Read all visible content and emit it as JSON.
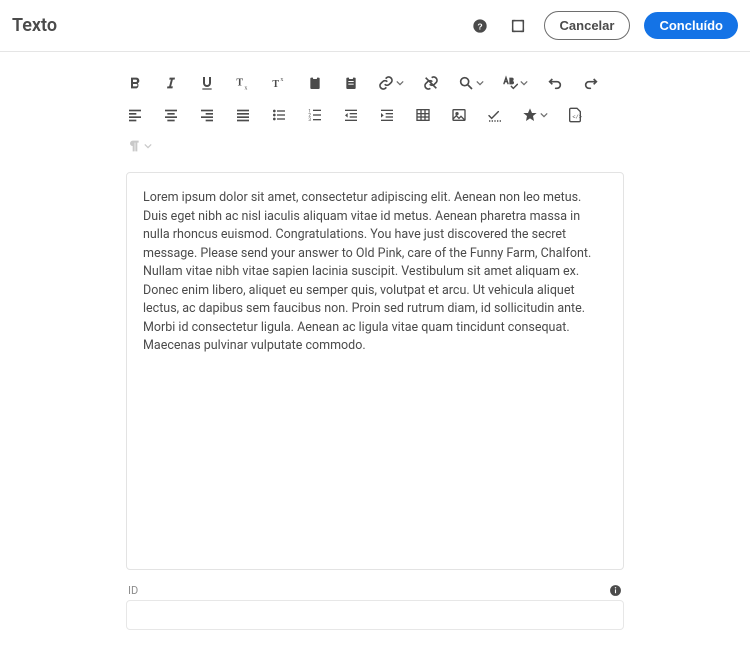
{
  "header": {
    "title": "Texto",
    "cancel_label": "Cancelar",
    "done_label": "Concluído"
  },
  "editor": {
    "body": "Lorem ipsum dolor sit amet, consectetur adipiscing elit. Aenean non leo metus. Duis eget nibh ac nisl iaculis aliquam vitae id metus. Aenean pharetra massa in nulla rhoncus euismod. Congratulations. You have just discovered the secret message. Please send your answer to Old Pink, care of the Funny Farm, Chalfont. Nullam vitae nibh vitae sapien lacinia suscipit. Vestibulum sit amet aliquam ex. Donec enim libero, aliquet eu semper quis, volutpat et arcu. Ut vehicula aliquet lectus, ac dapibus sem faucibus non. Proin sed rutrum diam, id sollicitudin ante. Morbi id consectetur ligula. Aenean ac ligula vitae quam tincidunt consequat. Maecenas pulvinar vulputate commodo."
  },
  "id_field": {
    "label": "ID",
    "value": ""
  }
}
